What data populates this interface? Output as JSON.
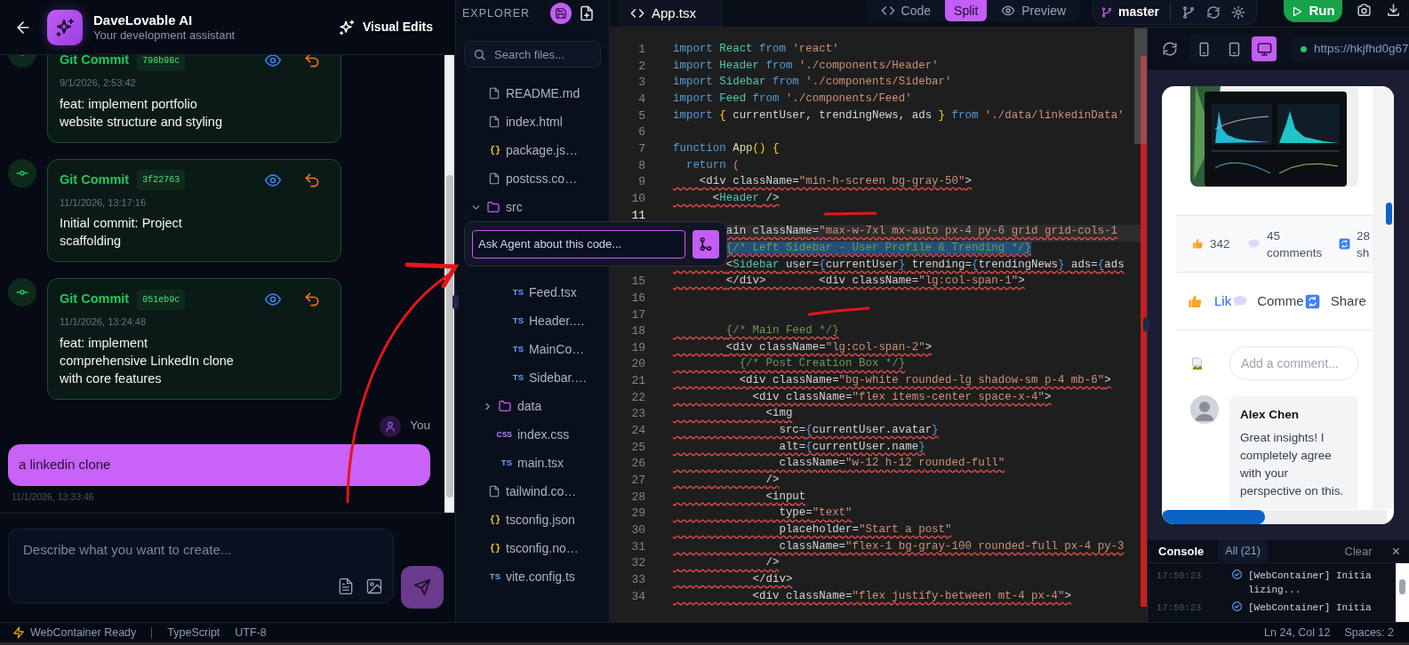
{
  "chat": {
    "header": {
      "title": "DaveLovable AI",
      "subtitle": "Your development assistant",
      "action": "Visual Edits"
    },
    "messages": [
      {
        "kind": "commit",
        "title": "Git Commit",
        "hash": "798b98c",
        "time": "9/1/2026, 2:53:42",
        "text": "feat: implement portfolio website structure and styling"
      },
      {
        "kind": "commit",
        "title": "Git Commit",
        "hash": "3f22763",
        "time": "11/1/2026, 13:17:16",
        "text": "Initial commit: Project scaffolding"
      },
      {
        "kind": "commit",
        "title": "Git Commit",
        "hash": "051eb9c",
        "time": "11/1/2026, 13:24:48",
        "text": "feat: implement comprehensive LinkedIn clone with core features"
      },
      {
        "kind": "user",
        "author": "You",
        "text": "a linkedin clone",
        "time": "11/1/2026, 13:33:46"
      }
    ],
    "composer": {
      "placeholder": "Describe what you want to create..."
    }
  },
  "explorer": {
    "title": "EXPLORER",
    "search": {
      "placeholder": "Search files..."
    },
    "tree": [
      {
        "kind": "doc",
        "name": "README.md"
      },
      {
        "kind": "doc",
        "name": "index.html"
      },
      {
        "kind": "json",
        "badge": "{}",
        "name": "package.js…"
      },
      {
        "kind": "doc",
        "name": "postcss.co…"
      },
      {
        "kind": "folder",
        "name": "src",
        "expanded": true,
        "children": [
          {
            "kind": "folder",
            "children": [
              {
                "kind": "ts",
                "badge": "TS",
                "name": "Feed.tsx"
              },
              {
                "kind": "ts",
                "badge": "TS",
                "name": "Header.…"
              },
              {
                "kind": "ts",
                "badge": "TS",
                "name": "MainCo…"
              },
              {
                "kind": "ts",
                "badge": "TS",
                "name": "Sidebar.…"
              }
            ]
          },
          {
            "kind": "folder",
            "name": "data",
            "expanded": false
          },
          {
            "kind": "css",
            "badge": "CSS",
            "name": "index.css"
          },
          {
            "kind": "ts",
            "badge": "TS",
            "name": "main.tsx"
          }
        ]
      },
      {
        "kind": "doc",
        "name": "tailwind.co…"
      },
      {
        "kind": "json",
        "badge": "{}",
        "name": "tsconfig.json"
      },
      {
        "kind": "json",
        "badge": "{}",
        "name": "tsconfig.no…"
      },
      {
        "kind": "ts",
        "badge": "TS",
        "name": "vite.config.ts"
      }
    ]
  },
  "editor": {
    "tab": "App.tsx",
    "lines": [
      {
        "n": "1",
        "tokens": [
          {
            "kind": "keyword",
            "text": "import "
          },
          {
            "kind": "type",
            "text": "React "
          },
          {
            "kind": "keyword",
            "text": "from "
          },
          {
            "kind": "string",
            "text": "'react'"
          }
        ]
      },
      {
        "n": "2",
        "tokens": [
          {
            "kind": "keyword",
            "text": "import "
          },
          {
            "kind": "type",
            "text": "Header "
          },
          {
            "kind": "keyword",
            "text": "from "
          },
          {
            "kind": "string",
            "text": "'./components/Header'"
          }
        ]
      },
      {
        "n": "3",
        "tokens": [
          {
            "kind": "keyword",
            "text": "import "
          },
          {
            "kind": "type",
            "text": "Sidebar "
          },
          {
            "kind": "keyword",
            "text": "from "
          },
          {
            "kind": "string",
            "text": "'./components/Sidebar'"
          }
        ]
      },
      {
        "n": "4",
        "tokens": [
          {
            "kind": "keyword",
            "text": "import "
          },
          {
            "kind": "type",
            "text": "Feed "
          },
          {
            "kind": "keyword",
            "text": "from "
          },
          {
            "kind": "string",
            "text": "'./components/Feed'"
          }
        ]
      },
      {
        "n": "5",
        "tokens": [
          {
            "kind": "keyword",
            "text": "import "
          },
          {
            "kind": "brace",
            "text": "{ "
          },
          {
            "kind": "plain",
            "text": "currentUser, trendingNews, ads "
          },
          {
            "kind": "brace",
            "text": "} "
          },
          {
            "kind": "keyword",
            "text": "from "
          },
          {
            "kind": "string",
            "text": "'./data/linkedinData'"
          }
        ]
      },
      {
        "n": "6"
      },
      {
        "n": "7",
        "tokens": [
          {
            "kind": "keyword",
            "text": "function "
          },
          {
            "kind": "function",
            "text": "App"
          },
          {
            "kind": "brace",
            "text": "() {"
          }
        ]
      },
      {
        "n": "8",
        "tokens": [
          {
            "kind": "keyword",
            "text": "  return "
          },
          {
            "kind": "paren",
            "text": "("
          }
        ]
      },
      {
        "n": "9",
        "error": true,
        "tokens": [
          {
            "kind": "plain",
            "text": "    <div className="
          },
          {
            "kind": "string",
            "text": "\"min-h-screen bg-gray-50\""
          },
          {
            "kind": "plain",
            "text": ">"
          }
        ]
      },
      {
        "n": "10",
        "error": true,
        "tokens": [
          {
            "kind": "plain",
            "text": "      <"
          },
          {
            "kind": "type",
            "text": "Header"
          },
          {
            "kind": "plain",
            "text": " />"
          }
        ]
      },
      {
        "n": "11",
        "current": true
      },
      {
        "error": true,
        "highlighted": true,
        "tokens": [
          {
            "kind": "plain",
            "text": "        ain className="
          },
          {
            "kind": "string",
            "text": "\"max-w-7xl mx-auto px-4 py-6 grid grid-cols-1"
          }
        ]
      },
      {
        "error": true,
        "text_selected": true,
        "tokens": [
          {
            "kind": "comment",
            "text": "        {/* Left Sidebar - User Profile & Trending */}"
          }
        ]
      },
      {
        "error": true,
        "tokens": [
          {
            "kind": "plain",
            "text": "        <"
          },
          {
            "kind": "type",
            "text": "Sidebar"
          },
          {
            "kind": "plain",
            "text": " user="
          },
          {
            "kind": "jsx",
            "text": "{"
          },
          {
            "kind": "plain",
            "text": "currentUser"
          },
          {
            "kind": "jsx",
            "text": "}"
          },
          {
            "kind": "plain",
            "text": " trending="
          },
          {
            "kind": "jsx",
            "text": "{"
          },
          {
            "kind": "plain",
            "text": "trendingNews"
          },
          {
            "kind": "jsx",
            "text": "}"
          },
          {
            "kind": "plain",
            "text": " ads="
          },
          {
            "kind": "jsx",
            "text": "{"
          },
          {
            "kind": "plain",
            "text": "ads"
          }
        ]
      },
      {
        "n": "15",
        "error": true,
        "tokens": [
          {
            "kind": "plain",
            "text": "        </div>        <div className="
          },
          {
            "kind": "string",
            "text": "\"lg:col-span-1\""
          },
          {
            "kind": "plain",
            "text": ">"
          }
        ]
      },
      {
        "n": "16"
      },
      {
        "n": "17"
      },
      {
        "n": "18",
        "error": true,
        "tokens": [
          {
            "kind": "comment",
            "text": "        {/* Main Feed */}"
          }
        ]
      },
      {
        "n": "19",
        "error": true,
        "tokens": [
          {
            "kind": "plain",
            "text": "        <div className="
          },
          {
            "kind": "string",
            "text": "\"lg:col-span-2\""
          },
          {
            "kind": "plain",
            "text": ">"
          }
        ]
      },
      {
        "n": "20",
        "error": true,
        "tokens": [
          {
            "kind": "comment",
            "text": "          {/* Post Creation Box */}"
          }
        ]
      },
      {
        "n": "21",
        "error": true,
        "tokens": [
          {
            "kind": "plain",
            "text": "          <div className="
          },
          {
            "kind": "string",
            "text": "\"bg-white rounded-lg shadow-sm p-4 mb-6\""
          },
          {
            "kind": "plain",
            "text": ">"
          }
        ]
      },
      {
        "n": "22",
        "error": true,
        "tokens": [
          {
            "kind": "plain",
            "text": "            <div className="
          },
          {
            "kind": "string",
            "text": "\"flex items-center space-x-4\""
          },
          {
            "kind": "plain",
            "text": ">"
          }
        ]
      },
      {
        "n": "23",
        "error": true,
        "tokens": [
          {
            "kind": "plain",
            "text": "              <img"
          }
        ]
      },
      {
        "n": "24",
        "error": true,
        "tokens": [
          {
            "kind": "plain",
            "text": "                src="
          },
          {
            "kind": "jsx",
            "text": "{"
          },
          {
            "kind": "plain",
            "text": "currentUser.avatar"
          },
          {
            "kind": "jsx",
            "text": "}"
          }
        ]
      },
      {
        "n": "25",
        "error": true,
        "tokens": [
          {
            "kind": "plain",
            "text": "                alt="
          },
          {
            "kind": "jsx",
            "text": "{"
          },
          {
            "kind": "plain",
            "text": "currentUser.name"
          },
          {
            "kind": "jsx",
            "text": "}"
          }
        ]
      },
      {
        "n": "26",
        "error": true,
        "tokens": [
          {
            "kind": "plain",
            "text": "                className="
          },
          {
            "kind": "string",
            "text": "\"w-12 h-12 rounded-full\""
          }
        ]
      },
      {
        "n": "27",
        "error": true,
        "tokens": [
          {
            "kind": "plain",
            "text": "              />"
          }
        ]
      },
      {
        "n": "28",
        "error": true,
        "tokens": [
          {
            "kind": "plain",
            "text": "              <input"
          }
        ]
      },
      {
        "n": "29",
        "error": true,
        "tokens": [
          {
            "kind": "plain",
            "text": "                type="
          },
          {
            "kind": "string",
            "text": "\"text\""
          }
        ]
      },
      {
        "n": "30",
        "error": true,
        "tokens": [
          {
            "kind": "plain",
            "text": "                placeholder="
          },
          {
            "kind": "string",
            "text": "\"Start a post\""
          }
        ]
      },
      {
        "n": "31",
        "error": true,
        "tokens": [
          {
            "kind": "plain",
            "text": "                className="
          },
          {
            "kind": "string",
            "text": "\"flex-1 bg-gray-100 rounded-full px-4 py-3"
          }
        ]
      },
      {
        "n": "32",
        "error": true,
        "tokens": [
          {
            "kind": "plain",
            "text": "              />"
          }
        ]
      },
      {
        "n": "33",
        "error": true,
        "tokens": [
          {
            "kind": "plain",
            "text": "            </div>"
          }
        ]
      },
      {
        "n": "34",
        "error": true,
        "tokens": [
          {
            "kind": "plain",
            "text": "            <div className="
          },
          {
            "kind": "string",
            "text": "\"flex justify-between mt-4 px-4\""
          },
          {
            "kind": "plain",
            "text": ">"
          }
        ]
      }
    ]
  },
  "agent_popup": {
    "placeholder": "Ask Agent about this code..."
  },
  "view_modes": [
    {
      "kind": "code",
      "label": "Code",
      "selected": false
    },
    {
      "kind": "split",
      "label": "Split",
      "selected": true
    },
    {
      "kind": "preview",
      "label": "Preview",
      "selected": false
    }
  ],
  "branch": "master",
  "run": "Run",
  "preview": {
    "devices": [
      {
        "kind": "phone",
        "selected": false
      },
      {
        "kind": "tablet",
        "selected": false
      },
      {
        "kind": "desktop",
        "selected": true
      }
    ],
    "url": "https://hkjfhd0g67",
    "post": {
      "stats": [
        {
          "kind": "like",
          "text": "342"
        },
        {
          "kind": "comment",
          "text": "45 comments"
        },
        {
          "kind": "share",
          "text": "28 sh"
        }
      ],
      "actions": [
        {
          "kind": "like",
          "label": "Lik"
        },
        {
          "kind": "comment",
          "label": "Comme"
        },
        {
          "kind": "share",
          "label": "Share"
        }
      ],
      "comment_box": {
        "placeholder": "Add a comment..."
      },
      "comments": [
        {
          "author": "Alex Chen",
          "text": "Great insights! I completely agree with your perspective on this."
        }
      ]
    }
  },
  "console": {
    "title": "Console",
    "filter": "All (21)",
    "clear": "Clear",
    "close": "×",
    "entries": [
      {
        "time": "17:50:23",
        "text": "[WebContainer] Initializing..."
      },
      {
        "time": "17:50:23",
        "text": "[WebContainer] Initia"
      }
    ]
  },
  "status_bar": {
    "left": [
      {
        "kind": "ready",
        "text": "WebContainer Ready"
      },
      {
        "kind": "language",
        "text": "TypeScript"
      },
      {
        "kind": "encoding",
        "text": "UTF-8"
      }
    ],
    "right": [
      "Ln 24, Col 12",
      "Spaces: 2"
    ]
  }
}
